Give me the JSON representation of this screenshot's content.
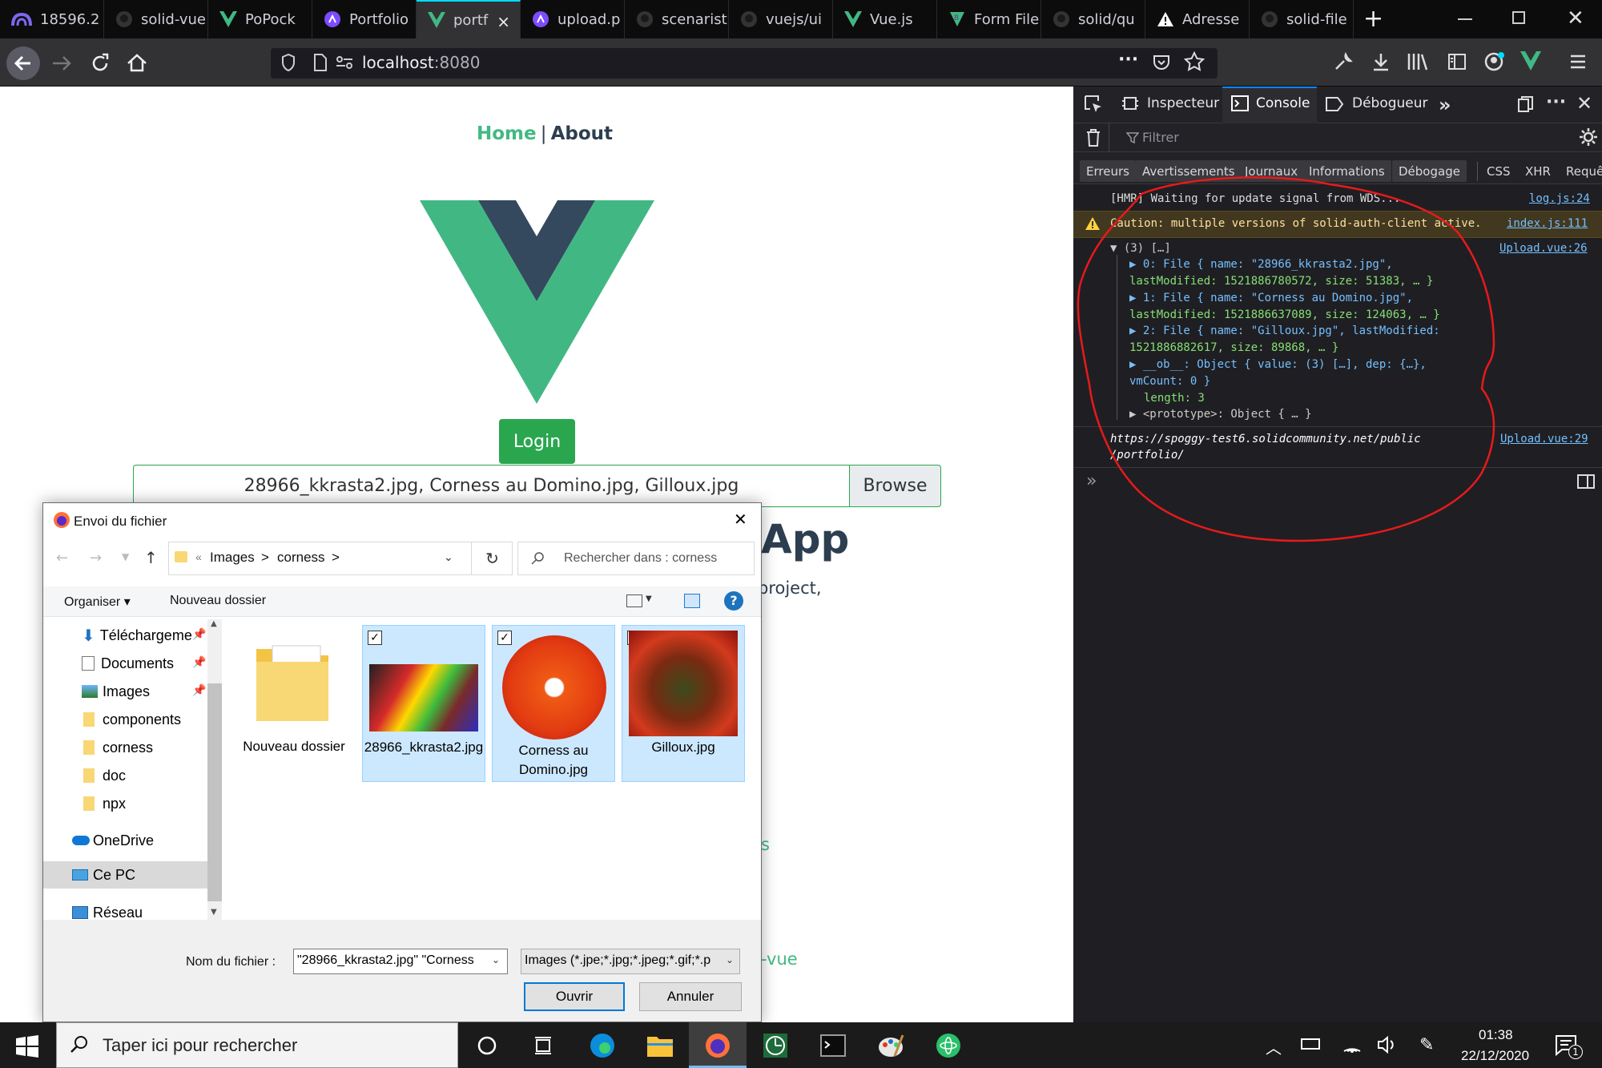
{
  "browser": {
    "tabs": [
      {
        "label": "18596.2",
        "icon": "hm-logo-icon"
      },
      {
        "label": "solid-vue",
        "icon": "github-icon"
      },
      {
        "label": "PoPock",
        "icon": "vue-icon"
      },
      {
        "label": "Portfolio",
        "icon": "polymer-icon"
      },
      {
        "label": "portf",
        "icon": "vue-icon",
        "active": true
      },
      {
        "label": "upload.p",
        "icon": "polymer-icon"
      },
      {
        "label": "scenarist",
        "icon": "github-icon"
      },
      {
        "label": "vuejs/ui",
        "icon": "github-icon"
      },
      {
        "label": "Vue.js",
        "icon": "vue-icon"
      },
      {
        "label": "Form File",
        "icon": "bootstrap-vue-icon"
      },
      {
        "label": "solid/qu",
        "icon": "github-icon"
      },
      {
        "label": "Adresse",
        "icon": "warning-icon"
      },
      {
        "label": "solid-file",
        "icon": "github-icon"
      }
    ],
    "tab_close": "×",
    "new_tab": "+",
    "url_host": "localhost",
    "url_port": ":8080",
    "url_more": "···",
    "accent": "#00ddff"
  },
  "page": {
    "nav_home": "Home",
    "nav_sep": "|",
    "nav_about": "About",
    "login_label": "Login",
    "file_input_value": "28966_kkrasta2.jpg, Corness au Domino.jpg, Gilloux.jpg",
    "browse_label": "Browse",
    "heading_fragment": "App",
    "text_fragment": "project,",
    "link_fragment_1": "s",
    "link_fragment_2": "-vue",
    "vue_green": "#41b883",
    "vue_dark": "#34495e"
  },
  "devtools": {
    "tabs": {
      "inspector": "Inspecteur",
      "console": "Console",
      "debugger": "Débogueur"
    },
    "filter_placeholder": "Filtrer",
    "filters": [
      "Erreurs",
      "Avertissements",
      "Journaux",
      "Informations",
      "Débogage"
    ],
    "net_filters": [
      "CSS",
      "XHR",
      "Requê"
    ],
    "log": {
      "hmr": "[HMR] Waiting for update signal from WDS...",
      "hmr_src": "log.js:24",
      "warn": "Caution: multiple versions of solid-auth-client active.",
      "warn_src": "index.js:111",
      "arr_head": "▼ (3) […]",
      "arr_src": "Upload.vue:26",
      "lines": [
        "▶ 0: File { name: \"28966_kkrasta2.jpg\",",
        "lastModified: 1521886780572, size: 51383, … }",
        "▶ 1: File { name: \"Corness au Domino.jpg\",",
        "lastModified: 1521886637089, size: 124063, … }",
        "▶ 2: File { name: \"Gilloux.jpg\", lastModified:",
        "1521886882617, size: 89868, … }",
        "▶ __ob__: Object { value: (3) […], dep: {…},",
        "vmCount: 0 }",
        "length: 3",
        "▶ <prototype>: Object { … }"
      ],
      "url_line1": "https://spoggy-test6.solidcommunity.net/public",
      "url_line2": "/portfolio/",
      "url_src": "Upload.vue:29",
      "prompt": "»"
    },
    "annotation_color": "#e8191b"
  },
  "dialog": {
    "title": "Envoi du fichier",
    "close": "✕",
    "breadcrumb": [
      "«",
      "Images",
      ">",
      "corness",
      ">"
    ],
    "search_placeholder": "Rechercher dans : corness",
    "organize": "Organiser ▾",
    "new_folder": "Nouveau dossier",
    "sidebar": [
      {
        "label": "Téléchargeme",
        "icon": "download-icon",
        "pinned": true
      },
      {
        "label": "Documents",
        "icon": "documents-icon",
        "pinned": true
      },
      {
        "label": "Images",
        "icon": "images-icon",
        "pinned": true
      },
      {
        "label": "components",
        "icon": "folder-icon"
      },
      {
        "label": "corness",
        "icon": "folder-icon"
      },
      {
        "label": "doc",
        "icon": "folder-icon"
      },
      {
        "label": "npx",
        "icon": "folder-icon"
      },
      {
        "label": "OneDrive",
        "icon": "onedrive-icon"
      },
      {
        "label": "Ce PC",
        "icon": "pc-icon",
        "selected": true
      },
      {
        "label": "Réseau",
        "icon": "network-icon"
      }
    ],
    "files": [
      {
        "label": "Nouveau dossier",
        "type": "folder",
        "selected": false
      },
      {
        "label": "28966_kkrasta2.jpg",
        "type": "image",
        "selected": true
      },
      {
        "label": "Corness au Domino.jpg",
        "type": "image",
        "selected": true
      },
      {
        "label": "Gilloux.jpg",
        "type": "image",
        "selected": true
      }
    ],
    "filename_label": "Nom du fichier :",
    "filename_value": "\"28966_kkrasta2.jpg\" \"Corness",
    "filetype_value": "Images (*.jpe;*.jpg;*.jpeg;*.gif;*.p",
    "open_label": "Ouvrir",
    "cancel_label": "Annuler"
  },
  "taskbar": {
    "search_placeholder": "Taper ici pour rechercher",
    "time": "01:38",
    "date": "22/12/2020",
    "notif_count": "1"
  }
}
